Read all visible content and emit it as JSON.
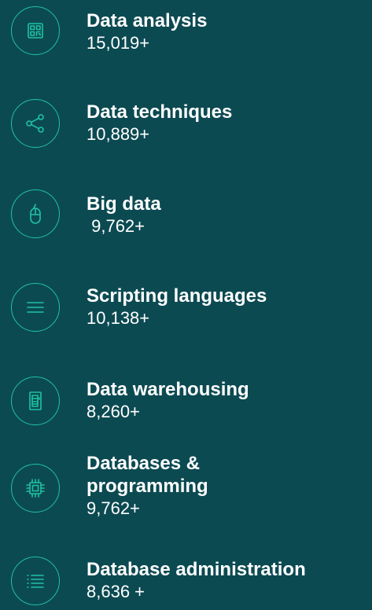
{
  "colors": {
    "background": "#0c4a52",
    "accent": "#1fc2a2",
    "text": "#ffffff"
  },
  "items": [
    {
      "icon": "qr-code-icon",
      "title": "Data analysis",
      "count": "15,019+"
    },
    {
      "icon": "share-icon",
      "title": "Data techniques",
      "count": "10,889+"
    },
    {
      "icon": "mouse-icon",
      "title": "Big data",
      "count": " 9,762+"
    },
    {
      "icon": "menu-lines-icon",
      "title": "Scripting languages",
      "count": "10,138+"
    },
    {
      "icon": "server-cabinet-icon",
      "title": "Data warehousing",
      "count": "8,260+"
    },
    {
      "icon": "chip-icon",
      "title": "Databases & programming",
      "count": "9,762+"
    },
    {
      "icon": "list-icon",
      "title": "Database administration",
      "count": "8,636 +"
    }
  ]
}
